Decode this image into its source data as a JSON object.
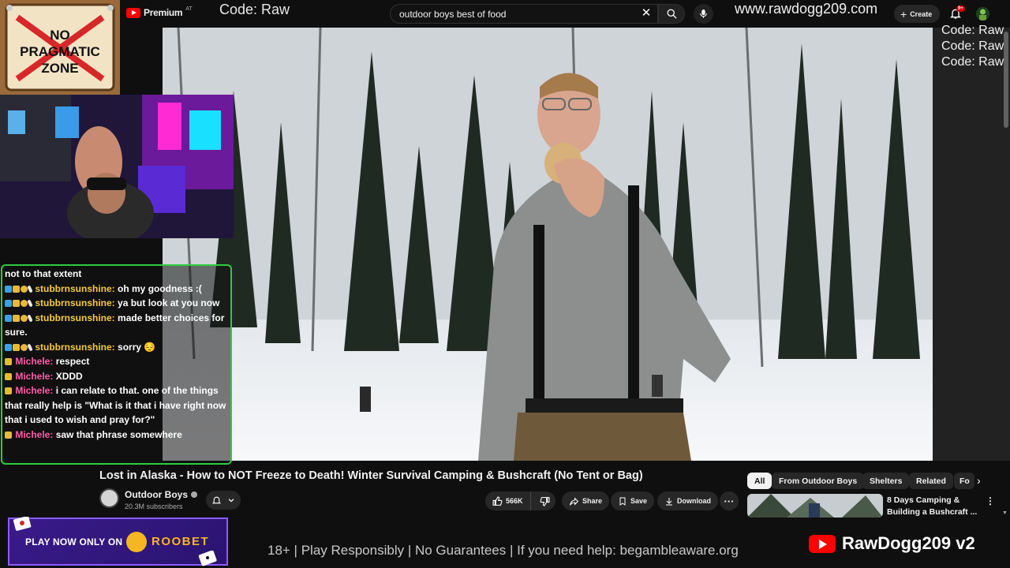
{
  "header": {
    "brand": "Premium",
    "region": "AT",
    "overlay_code": "Code: Raw",
    "search_query": "outdoor boys best of food",
    "overlay_url": "www.rawdogg209.com",
    "create_label": "Create",
    "notification_count": "9+"
  },
  "overlays": {
    "code_stack": [
      "Code: Raw",
      "Code: Raw",
      "Code: Raw"
    ],
    "no_pragmatic": [
      "NO",
      "PRAGMATIC",
      "ZONE"
    ]
  },
  "chat": {
    "messages": [
      {
        "name": "",
        "text": "not to that extent",
        "style": "plain"
      },
      {
        "name": "stubbrnsunshine:",
        "text": " oh my goodness :(",
        "style": "sub"
      },
      {
        "name": "stubbrnsunshine:",
        "text": " ya but look at you now",
        "style": "sub"
      },
      {
        "name": "stubbrnsunshine:",
        "text": " made better choices for sure.",
        "style": "sub"
      },
      {
        "name": "stubbrnsunshine:",
        "text": " sorry 😔",
        "style": "sub"
      },
      {
        "name": "Michele:",
        "text": " respect",
        "style": "mod"
      },
      {
        "name": "Michele:",
        "text": " XDDD",
        "style": "mod"
      },
      {
        "name": "Michele:",
        "text": " i can relate to that. one of the things that really help is \"What is it that i have right now that i used to wish and pray for?\"",
        "style": "mod"
      },
      {
        "name": "Michele:",
        "text": " saw that phrase somewhere",
        "style": "mod"
      }
    ]
  },
  "video": {
    "title": "Lost in Alaska - How to NOT Freeze to Death! Winter Survival Camping & Bushcraft (No Tent or Bag)",
    "channel": "Outdoor Boys",
    "subscribers": "20.3M subscribers",
    "likes": "566K",
    "share_label": "Share",
    "save_label": "Save",
    "download_label": "Download"
  },
  "related": {
    "chips": [
      "All",
      "From Outdoor Boys",
      "Shelters",
      "Related",
      "Fo"
    ],
    "first_title": "8 Days Camping & Building a Bushcraft ..."
  },
  "banner": {
    "play_text": "PLAY NOW ONLY ON",
    "brand": "ROOBET",
    "disclaimer": "18+ | Play Responsibly | No Guarantees | If you need help: begambleaware.org",
    "streamer": "RawDogg209 v2"
  },
  "colors": {
    "accent_red": "#ff0000",
    "chat_border": "#2ecc40",
    "roobet_gold": "#f5b623",
    "michele_pink": "#ff5ca8"
  }
}
